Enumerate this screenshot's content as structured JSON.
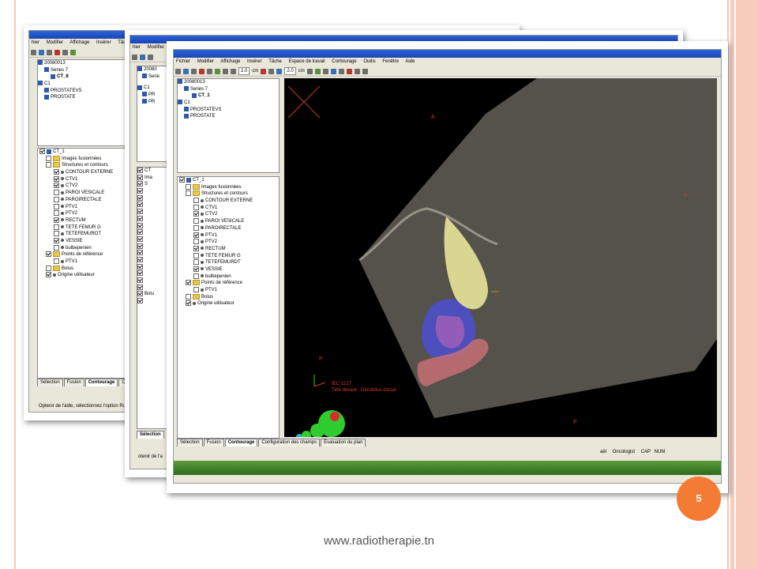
{
  "page_number": "5",
  "footer_url": "www.radiotherapie.tn",
  "back": {
    "menu": [
      "hier",
      "Modifier",
      "Affichage",
      "Insérer",
      "Tâche",
      "Es"
    ],
    "tree_top": [
      "20080013",
      "Series 7",
      "CT_8",
      "C1",
      "PROSTATEVS",
      "PROSTATE"
    ],
    "tree": [
      {
        "label": "CT_1",
        "kind": "ct",
        "checked": true
      },
      {
        "label": "Images fusionnées",
        "kind": "folder",
        "checked": false
      },
      {
        "label": "Structures et contours",
        "kind": "folder",
        "checked": false
      },
      {
        "label": "CONTOUR EXTERNE",
        "kind": "item",
        "checked": true
      },
      {
        "label": "CTV1",
        "kind": "item",
        "checked": true
      },
      {
        "label": "CTV2",
        "kind": "item",
        "checked": true
      },
      {
        "label": "PAROI VESICALE",
        "kind": "item",
        "checked": false
      },
      {
        "label": "PAROIRECTALE",
        "kind": "item",
        "checked": false
      },
      {
        "label": "PTV1",
        "kind": "item",
        "checked": false
      },
      {
        "label": "PTV2",
        "kind": "item",
        "checked": false
      },
      {
        "label": "RECTUM",
        "kind": "item",
        "checked": true
      },
      {
        "label": "TETE FEMUR G",
        "kind": "item",
        "checked": false
      },
      {
        "label": "TETEFEMUROT",
        "kind": "item",
        "checked": false
      },
      {
        "label": "VESSIE",
        "kind": "item",
        "checked": true
      },
      {
        "label": "bulbepenien",
        "kind": "item",
        "checked": false
      },
      {
        "label": "Points de référence",
        "kind": "folder",
        "checked": true
      },
      {
        "label": "PTV1",
        "kind": "ref",
        "checked": false
      },
      {
        "label": "Bolus",
        "kind": "folder",
        "checked": false
      },
      {
        "label": "Origine utilisateur",
        "kind": "origin",
        "checked": true
      }
    ],
    "tabs": [
      "Sélection",
      "Fusion",
      "Contourage",
      "Config"
    ],
    "status": "Optenir de l'aide, sélectionnez l'option Rubriques"
  },
  "middle": {
    "menu": [
      "hier",
      "Modifier"
    ],
    "tree_top": [
      "20080",
      "Serie",
      "C1",
      "PR",
      "PR"
    ],
    "tree_rows": [
      "CT",
      "Ima",
      "S",
      "",
      "",
      "",
      "",
      "",
      "",
      "",
      "",
      "",
      "",
      "",
      "",
      "",
      "",
      "",
      "Bolu",
      ""
    ],
    "tabs": [
      "Sélection"
    ],
    "status": "otenir de l'a"
  },
  "front": {
    "menu": [
      "Fichier",
      "Modifier",
      "Affichage",
      "Insérer",
      "Tâche",
      "Espace de travail",
      "Contourage",
      "Outils",
      "Fenêtre",
      "Aide"
    ],
    "toolbar": {
      "field1": "2.0",
      "unit1": "cm",
      "field2": "2.0",
      "unit2": "cm"
    },
    "tree_top": [
      "20080013",
      "Series 7",
      "CT_1",
      "C1",
      "PROSTATEVS",
      "PROSTATE"
    ],
    "tree": [
      {
        "label": "CT_1",
        "kind": "ct",
        "checked": true
      },
      {
        "label": "Images fusionnées",
        "kind": "folder",
        "checked": false
      },
      {
        "label": "Structures et contours",
        "kind": "folder",
        "checked": false
      },
      {
        "label": "CONTOUR EXTERNE",
        "kind": "item",
        "checked": false
      },
      {
        "label": "CTV1",
        "kind": "item",
        "checked": false
      },
      {
        "label": "CTV2",
        "kind": "item",
        "checked": true
      },
      {
        "label": "PAROI VESICALE",
        "kind": "item",
        "checked": false
      },
      {
        "label": "PAROIRECTALE",
        "kind": "item",
        "checked": false
      },
      {
        "label": "PTV1",
        "kind": "item",
        "checked": true
      },
      {
        "label": "PTV2",
        "kind": "item",
        "checked": false
      },
      {
        "label": "RECTUM",
        "kind": "item",
        "checked": true
      },
      {
        "label": "TETE FEMUR G",
        "kind": "item",
        "checked": false
      },
      {
        "label": "TETEFEMURDT",
        "kind": "item",
        "checked": false
      },
      {
        "label": "VESSIE",
        "kind": "item",
        "checked": true
      },
      {
        "label": "bulbepenien",
        "kind": "item",
        "checked": false
      },
      {
        "label": "Points de référence",
        "kind": "folder",
        "checked": true
      },
      {
        "label": "PTV1",
        "kind": "ref",
        "checked": false
      },
      {
        "label": "Bolus",
        "kind": "folder",
        "checked": false
      },
      {
        "label": "Origine utilisateur",
        "kind": "origin",
        "checked": true
      }
    ],
    "tabs": [
      "Sélection",
      "Fusion",
      "Contourage",
      "Configuration des champs",
      "Évaluation du plan"
    ],
    "active_tab": "Contourage",
    "status": {
      "user": "Oncologist",
      "cap": "CAP",
      "num": "NUM",
      "left": "aël"
    },
    "viewport_labels": {
      "a": "A",
      "t": "T",
      "p_top": "P",
      "p_bottom": "P",
      "iec": "IEC 1217",
      "pos": "Tête devant - Décubitus dorsal"
    },
    "colors": {
      "ptv": "#4b4fd0",
      "ctv": "#e8e49a",
      "rectum": "#c76e74",
      "body": "#bdb6a6",
      "accent": "#f47b34"
    }
  }
}
